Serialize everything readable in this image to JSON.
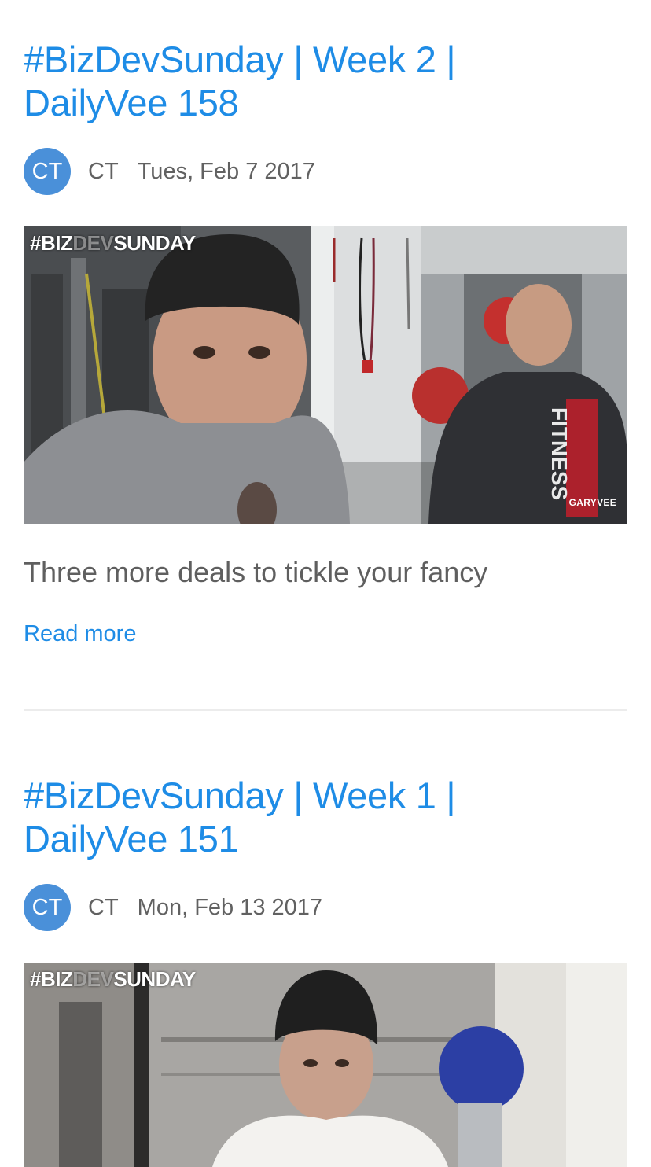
{
  "posts": [
    {
      "title": "#BizDevSunday | Week 2 | DailyVee 158",
      "avatar_initials": "CT",
      "author": "CT",
      "date": "Tues, Feb 7 2017",
      "image": {
        "overlay_tag_a": "#BIZ",
        "overlay_tag_b": "DEV",
        "overlay_tag_c": "SUNDAY",
        "watermark": "GARYVEE",
        "shirt_text": "FITNESS"
      },
      "excerpt": "Three more deals to tickle your fancy",
      "read_more": "Read more"
    },
    {
      "title": "#BizDevSunday | Week 1 | DailyVee 151",
      "avatar_initials": "CT",
      "author": "CT",
      "date": "Mon, Feb 13 2017",
      "image": {
        "overlay_tag_a": "#BIZ",
        "overlay_tag_b": "DEV",
        "overlay_tag_c": "SUNDAY"
      }
    }
  ],
  "colors": {
    "link": "#1e8ce6",
    "avatar": "#4a90d9",
    "text": "#5f5f5f",
    "divider": "#ececec"
  }
}
